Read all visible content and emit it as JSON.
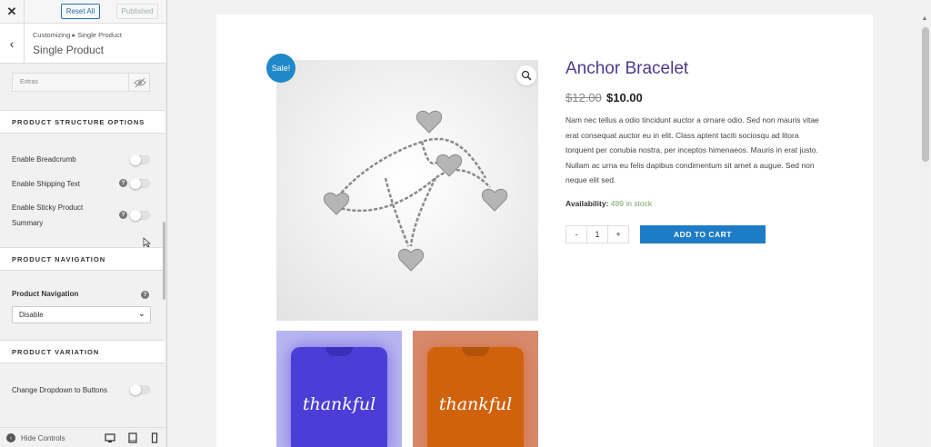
{
  "sidebar": {
    "close_icon": "close-icon",
    "reset_label": "Reset All",
    "published_label": "Published",
    "breadcrumb": "Customizing ▸ Single Product",
    "title": "Single Product",
    "extras_label": "Extras",
    "sections": {
      "structure": "PRODUCT STRUCTURE OPTIONS",
      "navigation": "PRODUCT NAVIGATION",
      "variation": "PRODUCT VARIATION"
    },
    "controls": {
      "breadcrumb": "Enable Breadcrumb",
      "shipping": "Enable Shipping Text",
      "sticky_line1": "Enable Sticky Product",
      "sticky_line2": "Summary",
      "nav_label": "Product Navigation",
      "nav_value": "Disable",
      "dropdown_buttons": "Change Dropdown to Buttons"
    },
    "footer": {
      "hide_label": "Hide Controls"
    }
  },
  "product": {
    "sale_badge": "Sale!",
    "title": "Anchor Bracelet",
    "old_price": "$12.00",
    "new_price": "$10.00",
    "description": "Nam nec tellus a odio tincidunt auctor a ornare odio. Sed non mauris vitae erat consequat auctor eu in elit. Class aptent taciti sociosqu ad litora torquent per conubia nostra, per inceptos himenaeos. Mauris in erat justo. Nullam ac urna eu felis dapibus condimentum sit amet a augue. Sed non neque elit sed.",
    "availability_label": "Availability:",
    "availability_value": "499 in stock",
    "qty_minus": "-",
    "qty_value": "1",
    "qty_plus": "+",
    "add_to_cart": "ADD TO CART",
    "thumb_text": "thankful"
  },
  "colors": {
    "accent_blue": "#1e7cc7",
    "title_purple": "#4e3a8a",
    "stock_green": "#77a464"
  }
}
